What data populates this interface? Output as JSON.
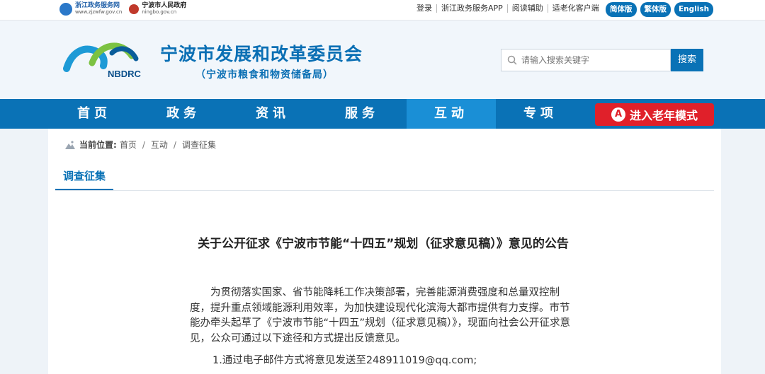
{
  "topbar": {
    "zj_portal_name": "浙江政务服务网",
    "zj_portal_url": "www.zjzwfw.gov.cn",
    "nb_gov_name": "宁波市人民政府",
    "nb_gov_url": "ningbo.gov.cn",
    "links": [
      "登录",
      "浙江政务服务APP",
      "阅读辅助",
      "适老化客户端"
    ],
    "lang_buttons": [
      "简体版",
      "繁体版",
      "English"
    ]
  },
  "header": {
    "logo_text": "NBDRC",
    "title": "宁波市发展和改革委员会",
    "subtitle": "（宁波市粮食和物资储备局）",
    "search_placeholder": "请输入搜索关键字",
    "search_button": "搜索"
  },
  "nav": {
    "items": [
      "首页",
      "政务",
      "资讯",
      "服务",
      "互动",
      "专项"
    ],
    "active_index": 4,
    "elder_mode_label": "进入老年模式"
  },
  "breadcrumb": {
    "label": "当前位置:",
    "items": [
      "首页",
      "互动",
      "调查征集"
    ]
  },
  "section_tab": "调查征集",
  "article": {
    "title": "关于公开征求《宁波市节能“十四五”规划（征求意见稿）》意见的公告",
    "body": "为贯彻落实国家、省节能降耗工作决策部署，完善能源消费强度和总量双控制度，提升重点领域能源利用效率，为加快建设现代化滨海大都市提供有力支撑。市节能办牵头起草了《宁波市节能“十四五”规划（征求意见稿）》，现面向社会公开征求意见，公众可通过以下途径和方式提出反馈意见。",
    "item1": "1.通过电子邮件方式将意见发送至248911019@qq.com;"
  },
  "colors": {
    "primary": "#0a72b6",
    "nav_active": "#1a8fd6",
    "elder_red": "#e0202a",
    "bg": "#eef3f8"
  }
}
